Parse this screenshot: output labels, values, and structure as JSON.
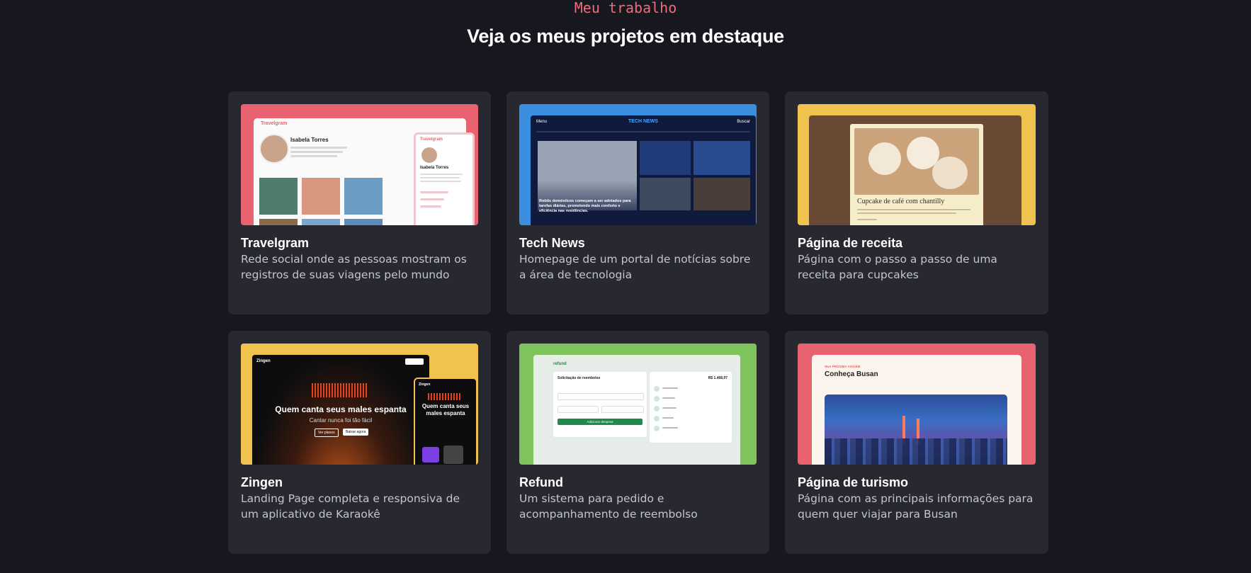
{
  "header": {
    "eyebrow": "Meu trabalho",
    "title": "Veja os meus projetos em destaque"
  },
  "projects": [
    {
      "title": "Travelgram",
      "description": "Rede social onde as pessoas mostram os registros de suas viagens pelo mundo",
      "accent": "#e8626f",
      "preview": {
        "logo": "Travelgram",
        "profile_name": "Isabela Torres"
      }
    },
    {
      "title": "Tech News",
      "description": "Homepage de um portal de notícias sobre a área de tecnologia",
      "accent": "#3a8fe0",
      "preview": {
        "logo": "TECH NEWS",
        "menu": "Menu",
        "search": "Buscar",
        "headline": "Robôs domésticos começam a ser adotados para tarefas diárias, prometendo mais conforto e eficiência nas residências."
      }
    },
    {
      "title": "Página de receita",
      "description": "Página com o passo a passo de uma receita para cupcakes",
      "accent": "#f0c24e",
      "preview": {
        "recipe_title": "Cupcake de café com chantilly"
      }
    },
    {
      "title": "Zingen",
      "description": "Landing Page completa e responsiva de um aplicativo de Karaokê",
      "accent": "#f0c24e",
      "preview": {
        "logo": "Zingen",
        "headline": "Quem canta seus males espanta",
        "subheadline": "Cantar nunca foi tão fácil",
        "cta_primary": "Baixar agora",
        "cta_secondary": "Ver planos"
      }
    },
    {
      "title": "Refund",
      "description": "Um sistema para pedido e acompanhamento de reembolso",
      "accent": "#7fc45a",
      "preview": {
        "logo": "refund",
        "form_title": "Solicitação de reembolso",
        "submit": "Adicionar despesa",
        "total": "R$ 1.468,97"
      }
    },
    {
      "title": "Página de turismo",
      "description": "Página com as principais informações para quem quer viajar para Busan",
      "accent": "#e8626f",
      "preview": {
        "eyebrow": "SUA PRÓXIMA VIAGEM",
        "heading": "Conheça Busan"
      }
    }
  ]
}
